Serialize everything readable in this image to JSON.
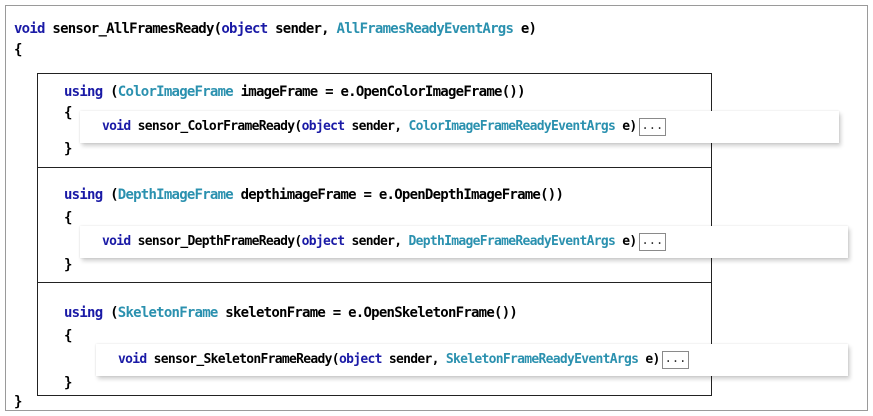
{
  "method": {
    "signature": {
      "kw_void": "void",
      "name": " sensor_AllFramesReady(",
      "kw_object": "object",
      "sender": " sender, ",
      "type": "AllFramesReadyEventArgs",
      "tail": " e)"
    },
    "open_brace": "{",
    "close_brace": "}"
  },
  "blocks": [
    {
      "using": {
        "kw_using": "using",
        "paren": " (",
        "type": "ColorImageFrame",
        "rest": " imageFrame = e.OpenColorImageFrame())"
      },
      "open_brace": "{",
      "close_brace": "}",
      "collapsed": {
        "kw_void": "void",
        "name": " sensor_ColorFrameReady(",
        "kw_object": "object",
        "sender": " sender, ",
        "type": "ColorImageFrameReadyEventArgs",
        "tail": " e)",
        "ellipsis": "..."
      }
    },
    {
      "using": {
        "kw_using": "using",
        "paren": " (",
        "type": "DepthImageFrame",
        "rest": " depthimageFrame = e.OpenDepthImageFrame())"
      },
      "open_brace": "{",
      "close_brace": "}",
      "collapsed": {
        "kw_void": "void",
        "name": " sensor_DepthFrameReady(",
        "kw_object": "object",
        "sender": " sender, ",
        "type": "DepthImageFrameReadyEventArgs",
        "tail": " e)",
        "ellipsis": "..."
      }
    },
    {
      "using": {
        "kw_using": "using",
        "paren": " (",
        "type": "SkeletonFrame",
        "rest": " skeletonFrame = e.OpenSkeletonFrame())"
      },
      "open_brace": "{",
      "close_brace": "}",
      "collapsed": {
        "kw_void": "void",
        "name": " sensor_SkeletonFrameReady(",
        "kw_object": "object",
        "sender": " sender, ",
        "type": "SkeletonFrameReadyEventArgs",
        "tail": " e)",
        "ellipsis": "..."
      }
    }
  ],
  "colors": {
    "keyword": "#1a1aa6",
    "type": "#2b91af",
    "text": "#000000"
  }
}
